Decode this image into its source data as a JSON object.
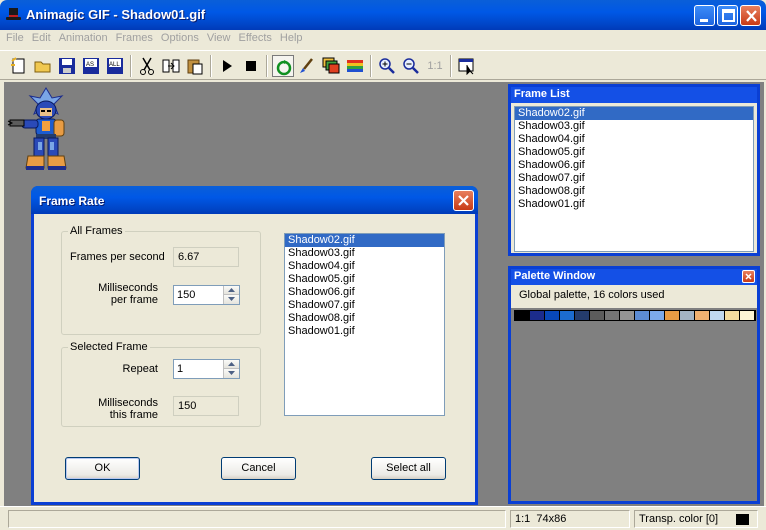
{
  "window": {
    "title": "Animagic GIF - Shadow01.gif"
  },
  "menu": [
    "File",
    "Edit",
    "Animation",
    "Frames",
    "Options",
    "View",
    "Effects",
    "Help"
  ],
  "toolbar": {
    "icons": [
      "new-icon",
      "open-icon",
      "save-icon",
      "save-as-icon",
      "save-all-icon",
      "cut-icon",
      "insert-icon",
      "paste-icon",
      "play-icon",
      "stop-icon",
      "loop-icon",
      "paint-icon",
      "frames-icon",
      "colors-icon",
      "zoom-in-icon",
      "zoom-out-icon",
      "zoom-1-1-icon",
      "properties-icon"
    ],
    "zoom_1_1_label": "1:1"
  },
  "frame_list": {
    "title": "Frame List",
    "items": [
      "Shadow02.gif",
      "Shadow03.gif",
      "Shadow04.gif",
      "Shadow05.gif",
      "Shadow06.gif",
      "Shadow07.gif",
      "Shadow08.gif",
      "Shadow01.gif"
    ],
    "selected_index": 0
  },
  "palette_window": {
    "title": "Palette Window",
    "description": "Global palette, 16 colors used",
    "colors": [
      "#000000",
      "#1c2c8c",
      "#0848b8",
      "#1c6cd0",
      "#243c6c",
      "#5c5c5c",
      "#747474",
      "#949494",
      "#5c8cd4",
      "#7caaea",
      "#e89c44",
      "#a4b4c4",
      "#f0b070",
      "#c0d8f0",
      "#f4dca0",
      "#fcf4d4"
    ]
  },
  "status": {
    "zoom": "1:1",
    "size": "74x86",
    "transparent": "Transp. color [0]",
    "transparent_color": "#000000"
  },
  "dialog": {
    "title": "Frame Rate",
    "all_frames": {
      "group_label": "All Frames",
      "fps_label": "Frames per second",
      "fps_value": "6.67",
      "ms_label_line1": "Milliseconds",
      "ms_label_line2": "per frame",
      "ms_value": "150"
    },
    "selected_frame": {
      "group_label": "Selected Frame",
      "repeat_label": "Repeat",
      "repeat_value": "1",
      "ms_label_line1": "Milliseconds",
      "ms_label_line2": "this frame",
      "ms_value": "150"
    },
    "frames": [
      "Shadow02.gif",
      "Shadow03.gif",
      "Shadow04.gif",
      "Shadow05.gif",
      "Shadow06.gif",
      "Shadow07.gif",
      "Shadow08.gif",
      "Shadow01.gif"
    ],
    "selected_index": 0,
    "ok_label": "OK",
    "cancel_label": "Cancel",
    "select_all_label": "Select all"
  }
}
